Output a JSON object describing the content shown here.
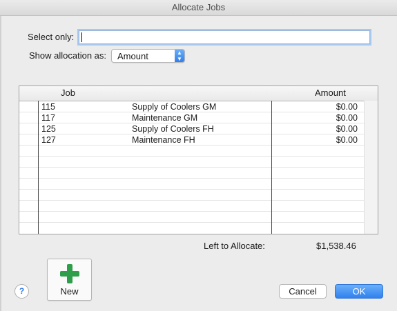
{
  "window": {
    "title": "Allocate Jobs"
  },
  "filter": {
    "select_only_label": "Select only:",
    "select_only_value": ""
  },
  "allocation": {
    "show_label": "Show allocation as:",
    "selected": "Amount"
  },
  "table": {
    "columns": [
      "Job",
      "Amount"
    ],
    "rows": [
      {
        "job": "115",
        "name": "Supply of Coolers GM",
        "amount": "$0.00"
      },
      {
        "job": "117",
        "name": "Maintenance GM",
        "amount": "$0.00"
      },
      {
        "job": "125",
        "name": "Supply of Coolers FH",
        "amount": "$0.00"
      },
      {
        "job": "127",
        "name": "Maintenance FH",
        "amount": "$0.00"
      }
    ]
  },
  "summary": {
    "left_label": "Left to Allocate:",
    "left_value": "$1,538.46"
  },
  "buttons": {
    "new": "New",
    "help": "?",
    "cancel": "Cancel",
    "ok": "OK"
  },
  "icons": {
    "new": "plus-icon",
    "help": "help-icon"
  },
  "colors": {
    "accent": "#2f80ee",
    "plus": "#2e9e4a"
  }
}
